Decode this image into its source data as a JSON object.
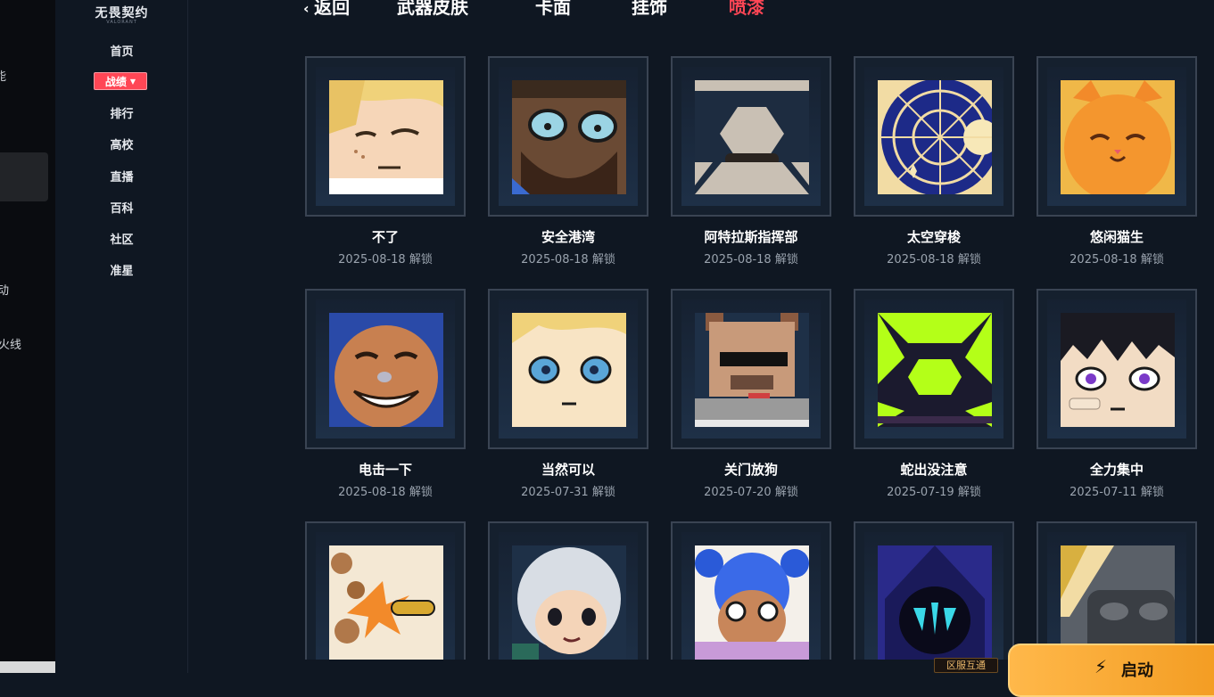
{
  "outer_left": {
    "items": [
      "能",
      "动",
      "火线"
    ]
  },
  "sidebar": {
    "logo": "无畏契约",
    "logo_sub": "VALORANT",
    "active": "战绩",
    "items": [
      "首页",
      "排行",
      "高校",
      "直播",
      "百科",
      "社区",
      "准星"
    ]
  },
  "topnav": {
    "back": "返回",
    "tabs": [
      "武器皮肤",
      "卡面",
      "挂饰",
      "喷漆"
    ],
    "active_tab": "喷漆"
  },
  "sprays": [
    {
      "name": "不了",
      "date": "2025-08-18 解锁",
      "icon": "blonde-sleeping-face"
    },
    {
      "name": "安全港湾",
      "date": "2025-08-18 解锁",
      "icon": "bearded-man-face"
    },
    {
      "name": "阿特拉斯指挥部",
      "date": "2025-08-18 解锁",
      "icon": "hexagon-emblem"
    },
    {
      "name": "太空穿梭",
      "date": "2025-08-18 解锁",
      "icon": "space-dial"
    },
    {
      "name": "悠闲猫生",
      "date": "2025-08-18 解锁",
      "icon": "orange-cat"
    },
    {
      "name": "电击一下",
      "date": "2025-08-18 解锁",
      "icon": "grinning-agent"
    },
    {
      "name": "当然可以",
      "date": "2025-07-31 解锁",
      "icon": "blue-eyed-agent"
    },
    {
      "name": "关门放狗",
      "date": "2025-07-20 解锁",
      "icon": "pixel-dog"
    },
    {
      "name": "蛇出没注意",
      "date": "2025-07-19 解锁",
      "icon": "green-hexagon"
    },
    {
      "name": "全力集中",
      "date": "2025-07-11 解锁",
      "icon": "purple-eyed-agent"
    },
    {
      "name": "",
      "date": "",
      "icon": "bullet-explosion"
    },
    {
      "name": "",
      "date": "",
      "icon": "silver-haired-agent"
    },
    {
      "name": "",
      "date": "",
      "icon": "blue-haired-girl"
    },
    {
      "name": "",
      "date": "",
      "icon": "hooded-omen"
    },
    {
      "name": "",
      "date": "",
      "icon": "gold-armor"
    }
  ],
  "launch": {
    "label": "启动"
  },
  "region": {
    "label": "区服互通"
  },
  "colors": {
    "accent": "#ff4655",
    "bg": "#0f1722",
    "launch": "#f5a42c"
  }
}
